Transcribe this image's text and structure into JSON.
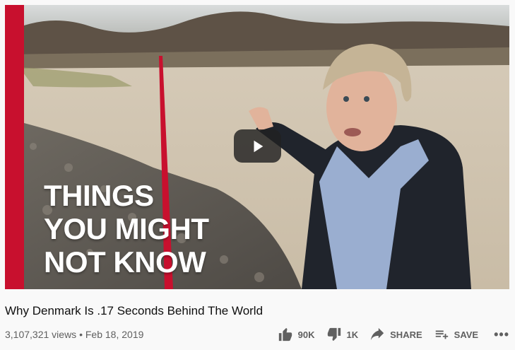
{
  "video": {
    "overlay_lines": [
      "THINGS",
      "YOU MIGHT",
      "NOT KNOW"
    ],
    "play_icon": "play-icon"
  },
  "info": {
    "title": "Why Denmark Is .17 Seconds Behind The World",
    "views": "3,107,321 views",
    "separator": "•",
    "date": "Feb 18, 2019"
  },
  "actions": {
    "like": {
      "label": "90K",
      "icon": "thumbs-up-icon"
    },
    "dislike": {
      "label": "1K",
      "icon": "thumbs-down-icon"
    },
    "share": {
      "label": "SHARE",
      "icon": "share-icon"
    },
    "save": {
      "label": "SAVE",
      "icon": "playlist-add-icon"
    },
    "more": {
      "label": "•••",
      "icon": "more-icon"
    }
  },
  "colors": {
    "accent_red": "#c8102e",
    "text_primary": "#0f0f0f",
    "text_secondary": "#606060"
  }
}
